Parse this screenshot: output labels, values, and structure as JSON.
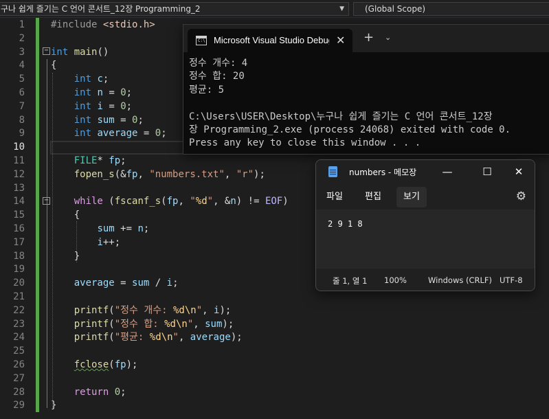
{
  "navbar": {
    "project": "구나 쉽게 즐기는 C 언어 콘서트_12장 Programming_2",
    "scope": "(Global Scope)"
  },
  "editor": {
    "current_line": 10,
    "line_numbers": [
      "1",
      "2",
      "3",
      "4",
      "5",
      "6",
      "7",
      "8",
      "9",
      "10",
      "11",
      "12",
      "13",
      "14",
      "15",
      "16",
      "17",
      "18",
      "19",
      "20",
      "21",
      "22",
      "23",
      "24",
      "25",
      "26",
      "27",
      "28",
      "29"
    ],
    "lines": [
      [
        [
          "#include",
          "pp"
        ],
        [
          " ",
          ""
        ],
        [
          "<stdio.h>",
          "inc"
        ]
      ],
      [],
      [
        [
          "int",
          "kw"
        ],
        [
          " ",
          ""
        ],
        [
          "main",
          "fn"
        ],
        [
          "()",
          ""
        ]
      ],
      [
        [
          "{",
          ""
        ]
      ],
      [
        [
          "    ",
          ""
        ],
        [
          "int",
          "kw"
        ],
        [
          " ",
          ""
        ],
        [
          "c",
          "vr"
        ],
        [
          ";",
          ""
        ]
      ],
      [
        [
          "    ",
          ""
        ],
        [
          "int",
          "kw"
        ],
        [
          " ",
          ""
        ],
        [
          "n",
          "vr"
        ],
        [
          " = ",
          ""
        ],
        [
          "0",
          "nm"
        ],
        [
          ";",
          ""
        ]
      ],
      [
        [
          "    ",
          ""
        ],
        [
          "int",
          "kw"
        ],
        [
          " ",
          ""
        ],
        [
          "i",
          "vr"
        ],
        [
          " = ",
          ""
        ],
        [
          "0",
          "nm"
        ],
        [
          ";",
          ""
        ]
      ],
      [
        [
          "    ",
          ""
        ],
        [
          "int",
          "kw"
        ],
        [
          " ",
          ""
        ],
        [
          "sum",
          "vr"
        ],
        [
          " = ",
          ""
        ],
        [
          "0",
          "nm"
        ],
        [
          ";",
          ""
        ]
      ],
      [
        [
          "    ",
          ""
        ],
        [
          "int",
          "kw"
        ],
        [
          " ",
          ""
        ],
        [
          "average",
          "vr"
        ],
        [
          " = ",
          ""
        ],
        [
          "0",
          "nm"
        ],
        [
          ";",
          ""
        ]
      ],
      [],
      [
        [
          "    ",
          ""
        ],
        [
          "FILE",
          "ty"
        ],
        [
          "* ",
          ""
        ],
        [
          "fp",
          "vr"
        ],
        [
          ";",
          ""
        ]
      ],
      [
        [
          "    ",
          ""
        ],
        [
          "fopen_s",
          "fn"
        ],
        [
          "(&",
          ""
        ],
        [
          "fp",
          "vr"
        ],
        [
          ", ",
          ""
        ],
        [
          "\"numbers.txt\"",
          "st"
        ],
        [
          ", ",
          ""
        ],
        [
          "\"r\"",
          "st"
        ],
        [
          ");",
          ""
        ]
      ],
      [],
      [
        [
          "    ",
          ""
        ],
        [
          "while",
          "ctl"
        ],
        [
          " (",
          ""
        ],
        [
          "fscanf_s",
          "fn"
        ],
        [
          "(",
          ""
        ],
        [
          "fp",
          "vr"
        ],
        [
          ", ",
          ""
        ],
        [
          "\"",
          "st"
        ],
        [
          "%d",
          "es"
        ],
        [
          "\"",
          "st"
        ],
        [
          ", &",
          ""
        ],
        [
          "n",
          "vr"
        ],
        [
          ") != ",
          ""
        ],
        [
          "EOF",
          "mc"
        ],
        [
          ")",
          ""
        ]
      ],
      [
        [
          "    {",
          ""
        ]
      ],
      [
        [
          "        ",
          ""
        ],
        [
          "sum",
          "vr"
        ],
        [
          " += ",
          ""
        ],
        [
          "n",
          "vr"
        ],
        [
          ";",
          ""
        ]
      ],
      [
        [
          "        ",
          ""
        ],
        [
          "i",
          "vr"
        ],
        [
          "++;",
          ""
        ]
      ],
      [
        [
          "    }",
          ""
        ]
      ],
      [],
      [
        [
          "    ",
          ""
        ],
        [
          "average",
          "vr"
        ],
        [
          " = ",
          ""
        ],
        [
          "sum",
          "vr"
        ],
        [
          " / ",
          ""
        ],
        [
          "i",
          "vr"
        ],
        [
          ";",
          ""
        ]
      ],
      [],
      [
        [
          "    ",
          ""
        ],
        [
          "printf",
          "fn"
        ],
        [
          "(",
          ""
        ],
        [
          "\"정수 개수: ",
          "st"
        ],
        [
          "%d",
          "es"
        ],
        [
          "\\n",
          "es"
        ],
        [
          "\"",
          "st"
        ],
        [
          ", ",
          ""
        ],
        [
          "i",
          "vr"
        ],
        [
          ");",
          ""
        ]
      ],
      [
        [
          "    ",
          ""
        ],
        [
          "printf",
          "fn"
        ],
        [
          "(",
          ""
        ],
        [
          "\"정수 합: ",
          "st"
        ],
        [
          "%d",
          "es"
        ],
        [
          "\\n",
          "es"
        ],
        [
          "\"",
          "st"
        ],
        [
          ", ",
          ""
        ],
        [
          "sum",
          "vr"
        ],
        [
          ");",
          ""
        ]
      ],
      [
        [
          "    ",
          ""
        ],
        [
          "printf",
          "fn"
        ],
        [
          "(",
          ""
        ],
        [
          "\"평균: ",
          "st"
        ],
        [
          "%d",
          "es"
        ],
        [
          "\\n",
          "es"
        ],
        [
          "\"",
          "st"
        ],
        [
          ", ",
          ""
        ],
        [
          "average",
          "vr"
        ],
        [
          ");",
          ""
        ]
      ],
      [],
      [
        [
          "    ",
          ""
        ],
        [
          "fclose",
          "fn squig"
        ],
        [
          "(",
          ""
        ],
        [
          "fp",
          "vr"
        ],
        [
          ");",
          ""
        ]
      ],
      [],
      [
        [
          "    ",
          ""
        ],
        [
          "return",
          "ctl"
        ],
        [
          " ",
          ""
        ],
        [
          "0",
          "nm"
        ],
        [
          ";",
          ""
        ]
      ],
      [
        [
          "}",
          ""
        ]
      ]
    ]
  },
  "console": {
    "tab_title": "Microsoft Visual Studio Debug",
    "app_icon_text": "C:\\",
    "close_glyph": "✕",
    "new_tab_glyph": "+",
    "dropdown_glyph": "⌄",
    "output": "정수 개수: 4\n정수 합: 20\n평균: 5\n\nC:\\Users\\USER\\Desktop\\누구나 쉽게 즐기는 C 언어 콘서트_12장\n장 Programming_2.exe (process 24068) exited with code 0.\nPress any key to close this window . . ."
  },
  "notepad": {
    "title": "numbers - 메모장",
    "minimize_glyph": "—",
    "maximize_glyph": "☐",
    "close_glyph": "✕",
    "menus": [
      "파일",
      "편집",
      "보기"
    ],
    "active_menu": "보기",
    "settings_glyph": "⚙",
    "content": "2 9 1 8",
    "status": {
      "position": "줄 1, 열 1",
      "zoom": "100%",
      "line_ending": "Windows (CRLF)",
      "encoding": "UTF-8"
    }
  },
  "colors": {
    "editor_bg": "#1e1e1e",
    "keyword": "#569cd6",
    "function": "#dcdcaa",
    "variable": "#9cdcfe",
    "string": "#d69d85",
    "number": "#b5cea8",
    "change_bar": "#57a64a",
    "console_bg": "#0c0c0c",
    "notepad_bg": "#202020"
  }
}
